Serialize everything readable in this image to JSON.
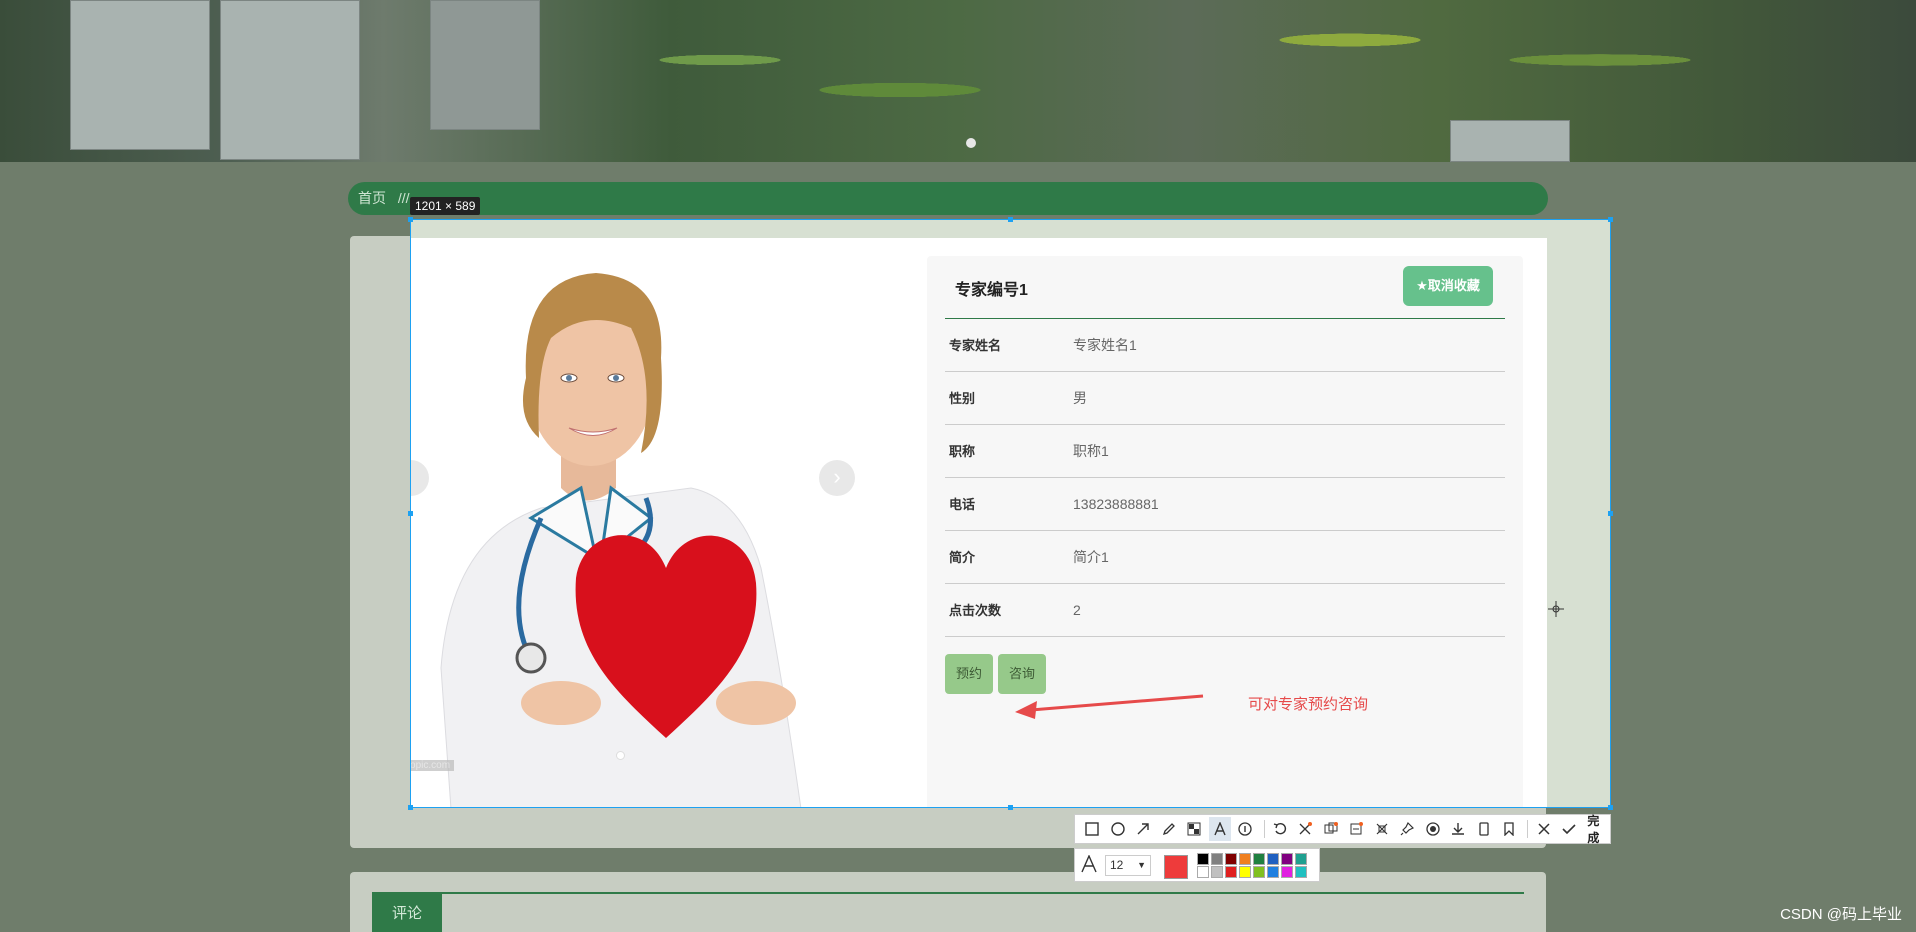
{
  "breadcrumb": {
    "home": "首页",
    "separator": "///",
    "current": ""
  },
  "screenshot": {
    "size_label": "1201 × 589"
  },
  "expert": {
    "title": "专家编号1",
    "favorite_button": "★取消收藏",
    "rows": [
      {
        "label": "专家姓名",
        "value": "专家姓名1"
      },
      {
        "label": "性别",
        "value": "男"
      },
      {
        "label": "职称",
        "value": "职称1"
      },
      {
        "label": "电话",
        "value": "13823888881"
      },
      {
        "label": "简介",
        "value": "简介1"
      },
      {
        "label": "点击次数",
        "value": "2"
      }
    ],
    "appointment_button": "预约",
    "consult_button": "咨询"
  },
  "annotation": {
    "text": "可对专家预约咨询",
    "color": "#e64a4a"
  },
  "carousel": {
    "prev_icon": "chevron-left-icon",
    "next_icon": "chevron-right-icon",
    "next_glyph": "›",
    "watermark": "www.ooopic.com"
  },
  "comments": {
    "tab_label": "评论"
  },
  "toolbar": {
    "done_label": "完成",
    "font_size": "12",
    "current_color": "#ee3b3b",
    "swatches": [
      "#000000",
      "#808080",
      "#800000",
      "#f08020",
      "#208040",
      "#2060c0",
      "#800080",
      "#20a090",
      "#ffffff",
      "#c0c0c0",
      "#e02020",
      "#ffff00",
      "#80c020",
      "#2080e0",
      "#e020e0",
      "#20c0c0"
    ]
  },
  "footer": {
    "watermark": "CSDN @码上毕业"
  },
  "colors": {
    "primary_green": "#2f7a48",
    "favorite_green": "#66c18c",
    "action_green": "#96c98a",
    "selection_blue": "#1da1f2"
  }
}
